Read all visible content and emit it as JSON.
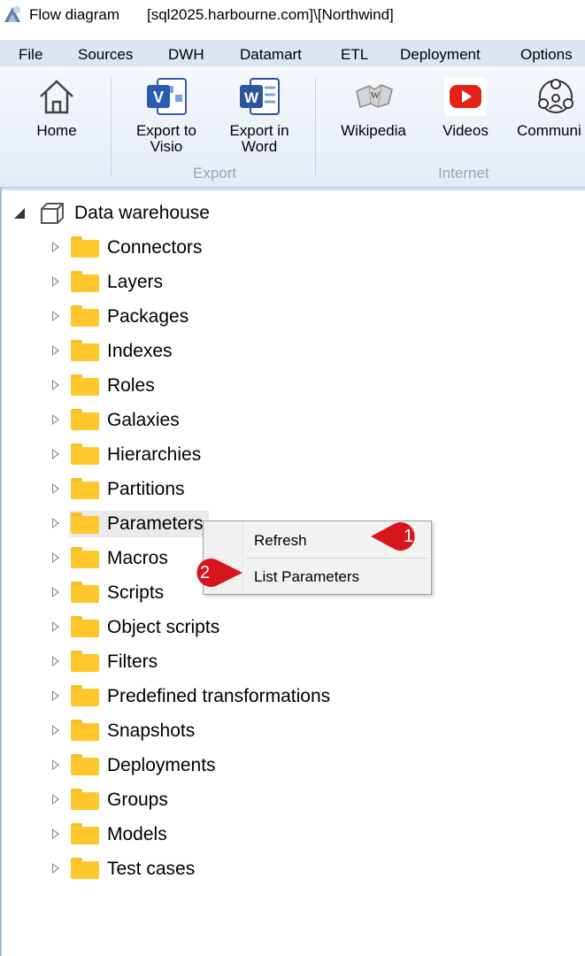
{
  "window": {
    "app_title": "Flow diagram",
    "connection_title": "[sql2025.harbourne.com]\\[Northwind]"
  },
  "menu": [
    "File",
    "Sources",
    "DWH",
    "Datamart",
    "ETL",
    "Deployment",
    "Options"
  ],
  "ribbon": {
    "home": "Home",
    "export_visio_l1": "Export to",
    "export_visio_l2": "Visio",
    "export_word_l1": "Export in",
    "export_word_l2": "Word",
    "export_group": "Export",
    "wikipedia": "Wikipedia",
    "videos": "Videos",
    "community": "Communi",
    "internet_group": "Internet"
  },
  "tree": {
    "root": "Data warehouse",
    "items": [
      "Connectors",
      "Layers",
      "Packages",
      "Indexes",
      "Roles",
      "Galaxies",
      "Hierarchies",
      "Partitions",
      "Parameters",
      "Macros",
      "Scripts",
      "Object scripts",
      "Filters",
      "Predefined transformations",
      "Snapshots",
      "Deployments",
      "Groups",
      "Models",
      "Test cases"
    ]
  },
  "context_menu": {
    "refresh": "Refresh",
    "list_parameters": "List Parameters"
  },
  "callouts": {
    "one": "1",
    "two": "2"
  },
  "colors": {
    "folder": "#ffc72c",
    "callout": "#d8141c",
    "menubar": "#dbe6f2"
  }
}
